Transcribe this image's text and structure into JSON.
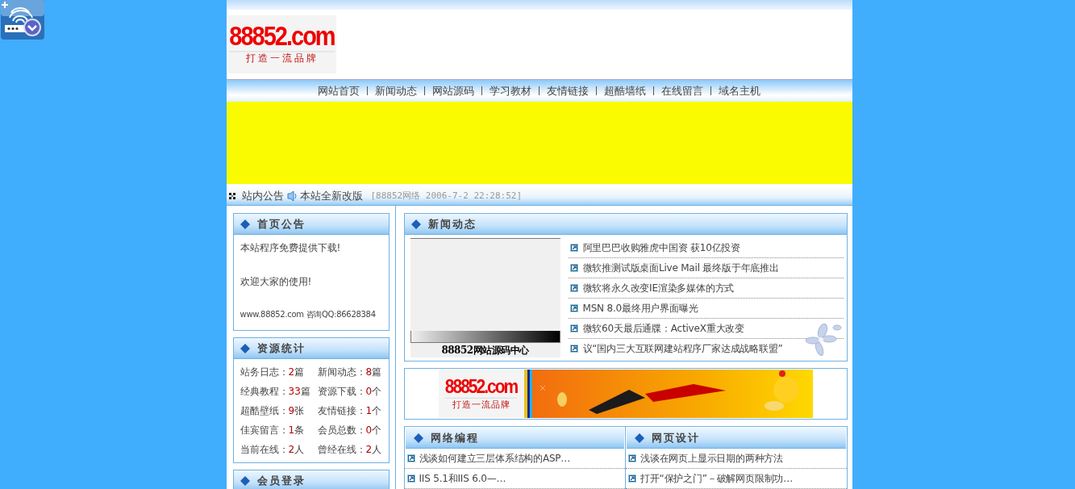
{
  "logo": {
    "name": "88852.com",
    "slogan": "打造一流品牌"
  },
  "nav": [
    "网站首页",
    "新闻动态",
    "网站源码",
    "学习教材",
    "友情链接",
    "超酷墙纸",
    "在线留言",
    "域名主机"
  ],
  "notice": {
    "label": "站内公告",
    "title": "本站全新改版",
    "meta": "[88852网络 2006-7-2 22:28:52]"
  },
  "sidebar": [
    {
      "kind": "text",
      "title": "首页公告",
      "lines": [
        "本站程序免费提供下载!",
        "欢迎大家的使用!",
        "www.88852.com 咨询QQ:86628384"
      ]
    },
    {
      "kind": "stats",
      "title": "资源统计",
      "stats": [
        {
          "label": "站务日志：",
          "count": "2",
          "unit": "篇"
        },
        {
          "label": "新闻动态：",
          "count": "8",
          "unit": "篇"
        },
        {
          "label": "经典教程：",
          "count": "33",
          "unit": "篇"
        },
        {
          "label": "资源下载：",
          "count": "0",
          "unit": "个"
        },
        {
          "label": "超酷壁纸：",
          "count": "9",
          "unit": "张"
        },
        {
          "label": "友情链接：",
          "count": "1",
          "unit": "个"
        },
        {
          "label": "佳宾留言：",
          "count": "1",
          "unit": "条"
        },
        {
          "label": "会员总数：",
          "count": "0",
          "unit": "个"
        },
        {
          "label": "当前在线：",
          "count": "2",
          "unit": "人"
        },
        {
          "label": "曾经在线：",
          "count": "2",
          "unit": "人"
        }
      ]
    },
    {
      "kind": "login",
      "title": "会员登录"
    }
  ],
  "news": {
    "title": "新闻动态",
    "image_caption": "88852网站源码中心",
    "items": [
      "阿里巴巴收购雅虎中国资 获10亿投资",
      "微软推测试版桌面Live Mail 最终版于年底推出",
      "微软将永久改变IE渲染多媒体的方式",
      "MSN 8.0最终用户界面曝光",
      "微软60天最后通牒：ActiveX重大改变",
      "议“国内三大互联网建站程序厂家达成战略联盟”"
    ]
  },
  "ad": {
    "logo": {
      "name": "88852.com",
      "slogan": "打造一流品牌"
    }
  },
  "columns": [
    {
      "title": "网络编程",
      "items": [
        "浅谈如何建立三层体系结构的ASP…",
        "IIS 5.1和IIS 6.0—…"
      ]
    },
    {
      "title": "网页设计",
      "items": [
        "浅谈在网页上显示日期的两种方法",
        "打开“保护之门”－破解网页限制功…"
      ]
    }
  ]
}
